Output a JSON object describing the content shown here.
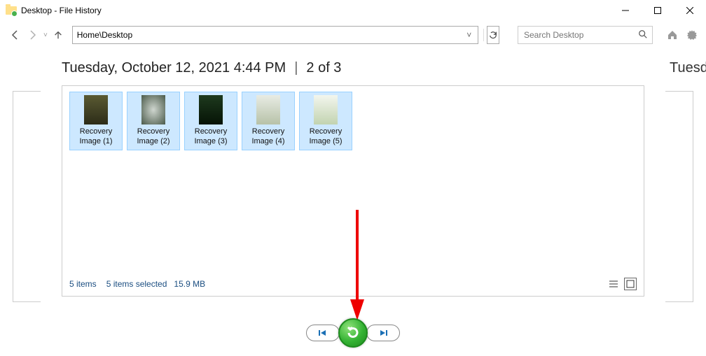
{
  "window": {
    "title": "Desktop - File History"
  },
  "toolbar": {
    "address": "Home\\Desktop",
    "search_placeholder": "Search Desktop"
  },
  "snapshot": {
    "timestamp": "Tuesday, October 12, 2021 4:44 PM",
    "position": "2 of 3",
    "next_peek": "Tuesda"
  },
  "files": [
    {
      "label_line1": "Recovery",
      "label_line2": "Image (1)"
    },
    {
      "label_line1": "Recovery",
      "label_line2": "Image (2)"
    },
    {
      "label_line1": "Recovery",
      "label_line2": "Image (3)"
    },
    {
      "label_line1": "Recovery",
      "label_line2": "Image (4)"
    },
    {
      "label_line1": "Recovery",
      "label_line2": "Image (5)"
    }
  ],
  "status": {
    "count": "5 items",
    "selection": "5 items selected",
    "size": "15.9 MB"
  }
}
